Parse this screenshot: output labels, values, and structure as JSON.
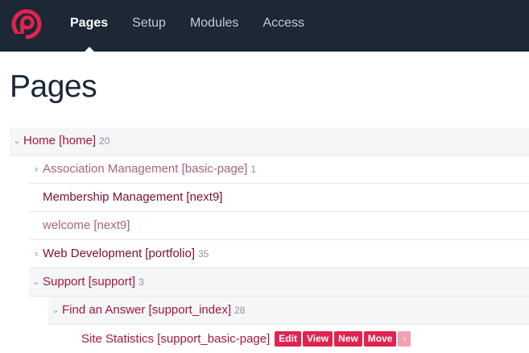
{
  "nav": {
    "items": [
      {
        "label": "Pages",
        "active": true
      },
      {
        "label": "Setup"
      },
      {
        "label": "Modules"
      },
      {
        "label": "Access"
      }
    ]
  },
  "page": {
    "title": "Pages"
  },
  "tree": {
    "home": {
      "label": "Home [home]",
      "count": "20"
    },
    "association": {
      "label": "Association Management [basic-page]",
      "count": "1"
    },
    "membership": {
      "label": "Membership Management [next9]"
    },
    "welcome": {
      "label": "welcome [next9]"
    },
    "webdev": {
      "label": "Web Development [portfolio]",
      "count": "35"
    },
    "support": {
      "label": "Support [support]",
      "count": "3"
    },
    "find_answer": {
      "label": "Find an Answer [support_index]",
      "count": "28"
    },
    "site_stats": {
      "label": "Site Statistics [support_basic-page]"
    }
  },
  "actions": {
    "edit": "Edit",
    "view": "View",
    "new": "New",
    "move": "Move",
    "more": "›"
  },
  "colors": {
    "topbar": "#1c2836",
    "accent": "#e0244f",
    "link": "#a3183c"
  }
}
